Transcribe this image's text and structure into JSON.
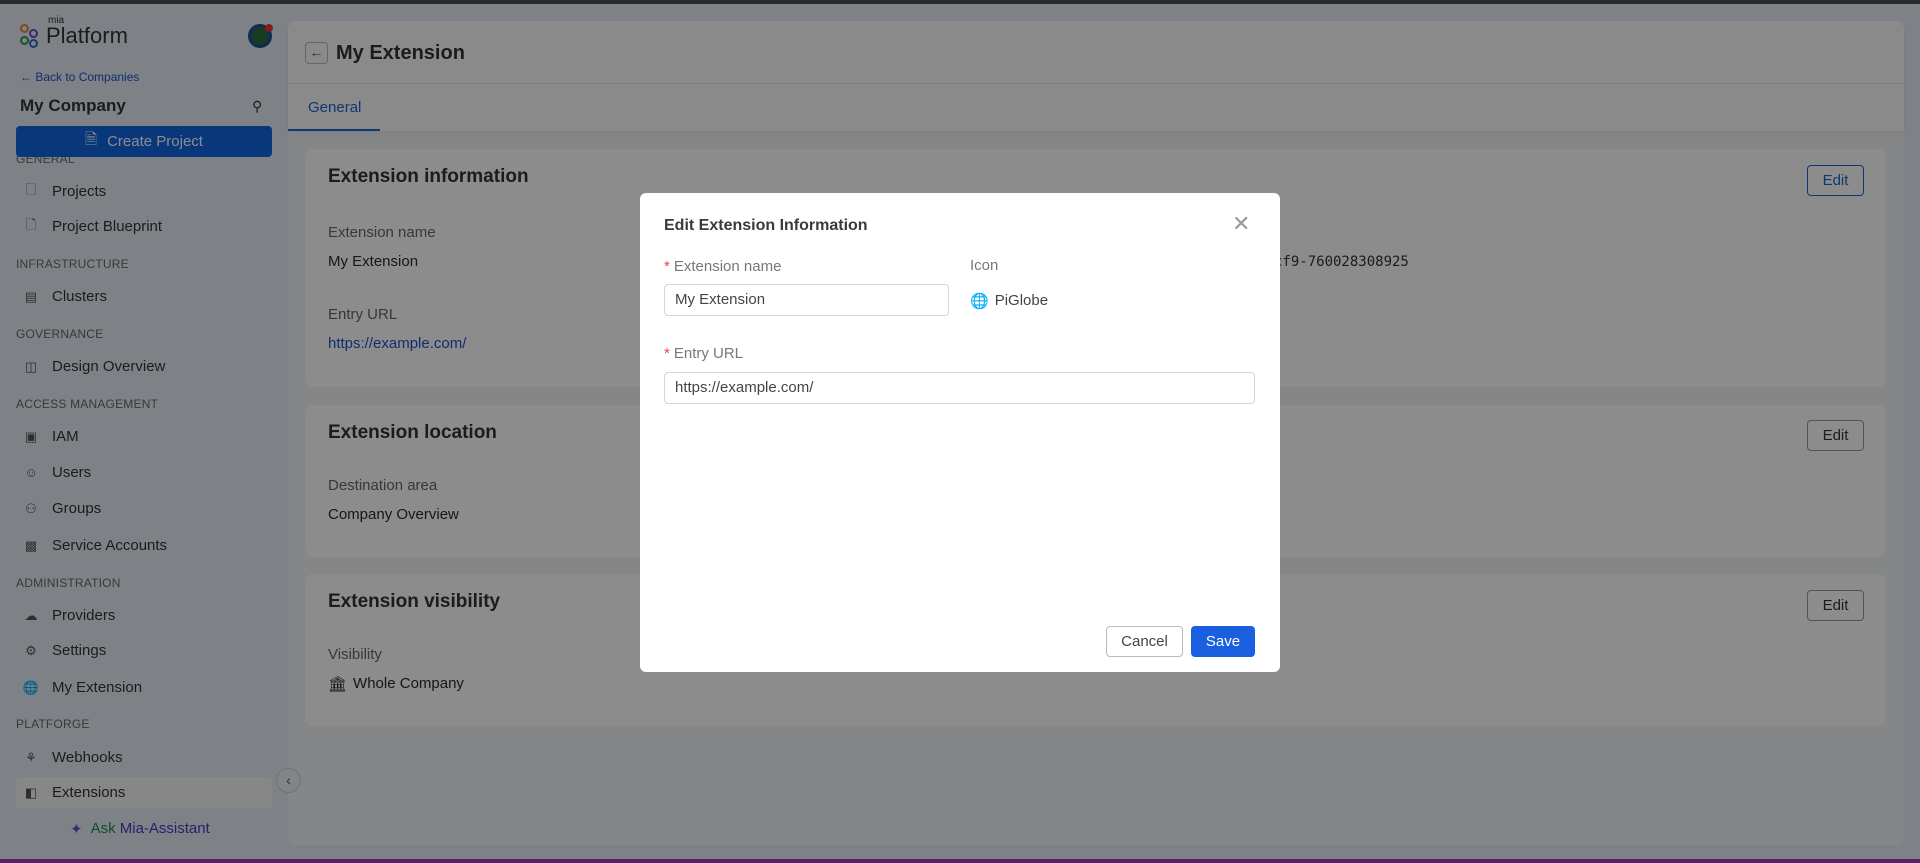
{
  "sidebar": {
    "logo_small": "mia",
    "logo_text": "Platform",
    "back_link": "← Back to Companies",
    "company": "My Company",
    "create_project": "Create Project",
    "sections": {
      "general": "GENERAL",
      "infrastructure": "INFRASTRUCTURE",
      "governance": "GOVERNANCE",
      "access": "ACCESS MANAGEMENT",
      "administration": "ADMINISTRATION",
      "platforge": "PLATFORGE"
    },
    "items": [
      {
        "label": "Projects",
        "icon": "file-code-icon"
      },
      {
        "label": "Project Blueprint",
        "icon": "file-blueprint-icon"
      },
      {
        "label": "Clusters",
        "icon": "server-icon"
      },
      {
        "label": "Design Overview",
        "icon": "presentation-icon"
      },
      {
        "label": "IAM",
        "icon": "scan-user-icon"
      },
      {
        "label": "Users",
        "icon": "user-icon"
      },
      {
        "label": "Groups",
        "icon": "users-group-icon"
      },
      {
        "label": "Service Accounts",
        "icon": "robot-icon"
      },
      {
        "label": "Providers",
        "icon": "cloud-gear-icon"
      },
      {
        "label": "Settings",
        "icon": "gear-icon"
      },
      {
        "label": "My Extension",
        "icon": "globe-icon"
      },
      {
        "label": "Webhooks",
        "icon": "webhook-icon"
      },
      {
        "label": "Extensions",
        "icon": "sidebar-panel-icon",
        "active": true
      }
    ],
    "ask_1": "Ask",
    "ask_2": "Mia-Assistant"
  },
  "header": {
    "title": "My Extension",
    "tabs": [
      "General"
    ]
  },
  "cards": {
    "info": {
      "title": "Extension information",
      "edit": "Edit",
      "name_label": "Extension name",
      "name_value": "My Extension",
      "id_value": "cf9-760028308925",
      "url_label": "Entry URL",
      "url_value": "https://example.com/"
    },
    "location": {
      "title": "Extension location",
      "edit": "Edit",
      "dest_label": "Destination area",
      "dest_value": "Company Overview"
    },
    "visibility": {
      "title": "Extension visibility",
      "edit": "Edit",
      "vis_label": "Visibility",
      "vis_value": "Whole Company"
    }
  },
  "modal": {
    "title": "Edit Extension Information",
    "name_label": "Extension name",
    "name_value": "My Extension",
    "icon_label": "Icon",
    "icon_value": "PiGlobe",
    "url_label": "Entry URL",
    "url_value": "https://example.com/",
    "cancel": "Cancel",
    "save": "Save"
  },
  "colors": {
    "primary": "#1264e0",
    "required": "#e5484d",
    "link": "#1a56c7"
  }
}
